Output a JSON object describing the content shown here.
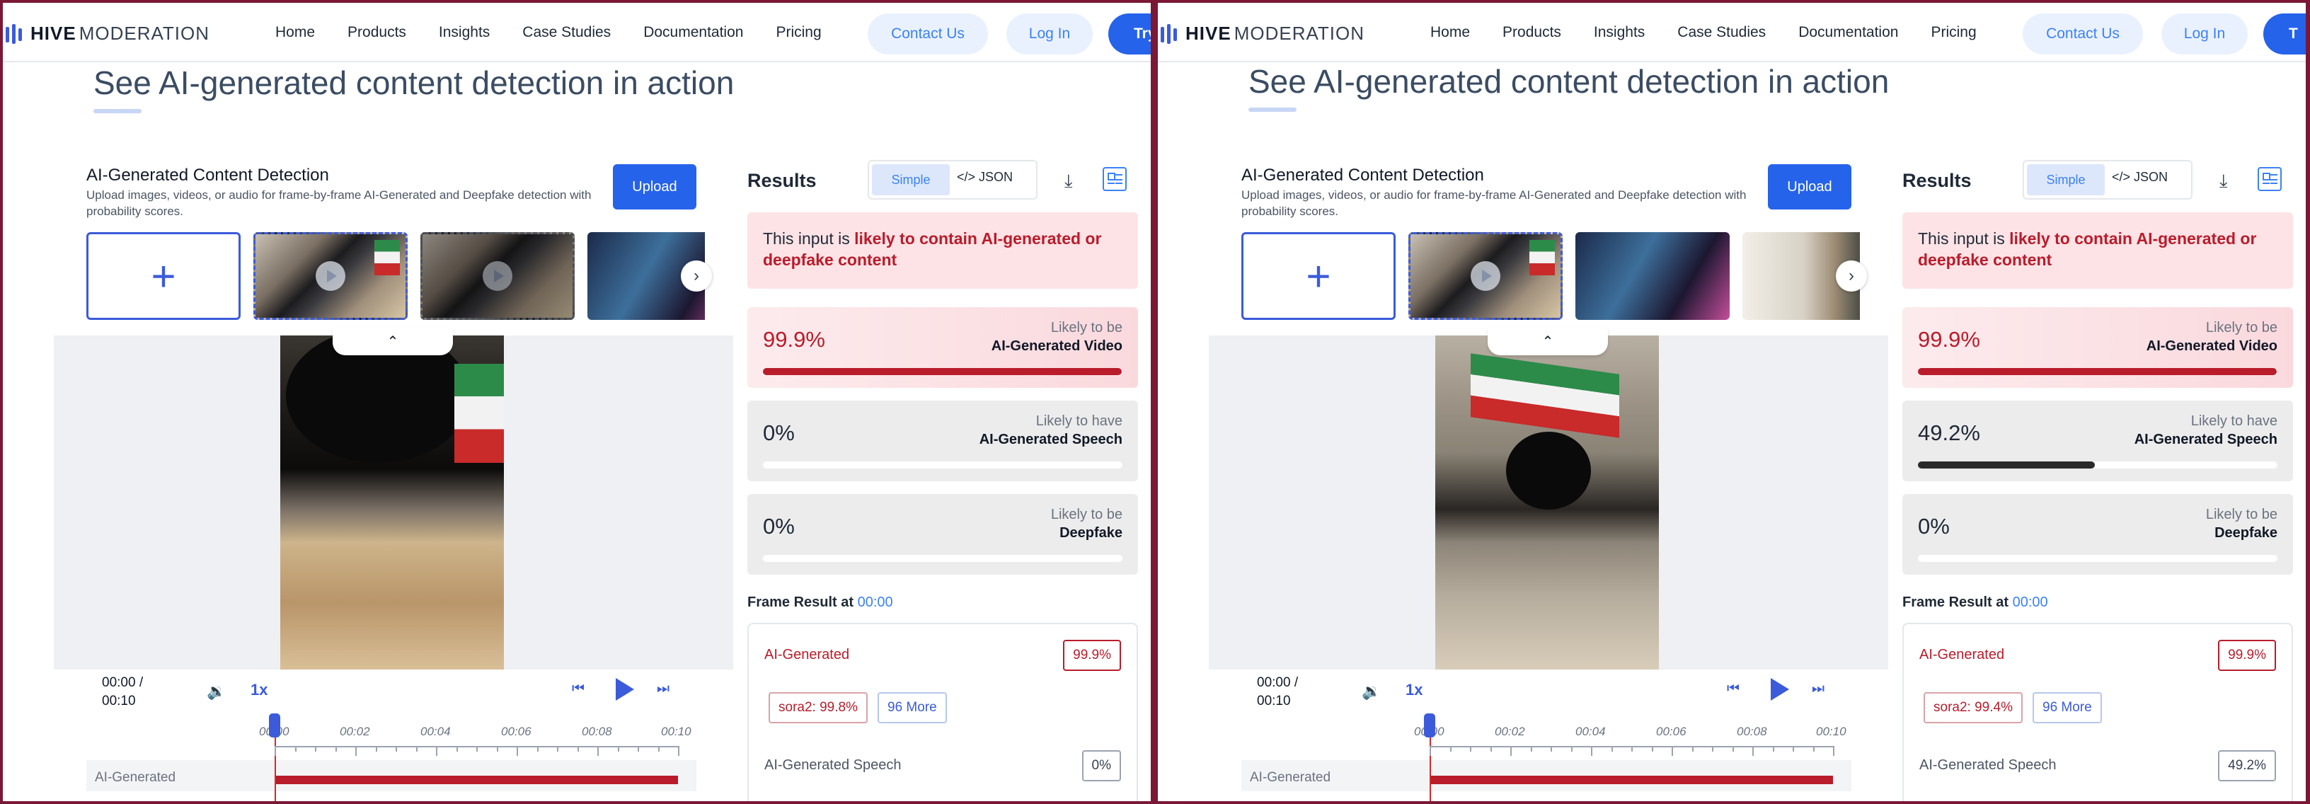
{
  "nav": {
    "brand_bold": "HIVE",
    "brand_rest": "MODERATION",
    "links": [
      "Home",
      "Products",
      "Insights",
      "Case Studies",
      "Documentation",
      "Pricing"
    ],
    "contact": "Contact Us",
    "login": "Log In",
    "try_left": "Try",
    "try_right": "T"
  },
  "heading": "See AI-generated content detection in action",
  "detector": {
    "title": "AI-Generated Content Detection",
    "description": "Upload images, videos, or audio for frame-by-frame AI-Generated and Deepfake detection with probability scores.",
    "upload_label": "Upload",
    "add_symbol": "+",
    "next_symbol": "›",
    "collapse_symbol": "⌃"
  },
  "player": {
    "time": "00:00 /",
    "duration": "00:10",
    "speed": "1x",
    "ticks": [
      "00:00",
      "00:02",
      "00:04",
      "00:06",
      "00:08",
      "00:10"
    ],
    "track_label": "AI-Generated"
  },
  "results": {
    "title": "Results",
    "simple_label": "Simple",
    "json_label": "</> JSON",
    "alert_prefix": "This input is ",
    "alert_strong": "likely to contain AI-generated or deepfake content"
  },
  "panels": {
    "left": {
      "cards": [
        {
          "value": "99.9%",
          "likely": "Likely to be",
          "category": "AI-Generated Video",
          "level": 0.999
        },
        {
          "value": "0%",
          "likely": "Likely to have",
          "category": "AI-Generated Speech",
          "level": 0
        },
        {
          "value": "0%",
          "likely": "Likely to be",
          "category": "Deepfake",
          "level": 0
        }
      ],
      "frame_result_label": "Frame Result at ",
      "frame_time": "00:00",
      "frame_ai_label": "AI-Generated",
      "frame_ai_value": "99.9%",
      "model_tag": "sora2: 99.8%",
      "more_tag": "96 More",
      "speech_label": "AI-Generated Speech",
      "speech_value": "0%"
    },
    "right": {
      "cards": [
        {
          "value": "99.9%",
          "likely": "Likely to be",
          "category": "AI-Generated Video",
          "level": 0.999
        },
        {
          "value": "49.2%",
          "likely": "Likely to have",
          "category": "AI-Generated Speech",
          "level": 0.492
        },
        {
          "value": "0%",
          "likely": "Likely to be",
          "category": "Deepfake",
          "level": 0
        }
      ],
      "frame_result_label": "Frame Result at ",
      "frame_time": "00:00",
      "frame_ai_label": "AI-Generated",
      "frame_ai_value": "99.9%",
      "model_tag": "sora2: 99.4%",
      "more_tag": "96 More",
      "speech_label": "AI-Generated Speech",
      "speech_value": "49.2%"
    }
  },
  "colors": {
    "accent": "#2563eb",
    "alert_red": "#b91c2b",
    "speech_bar": "#2b2b2b"
  }
}
